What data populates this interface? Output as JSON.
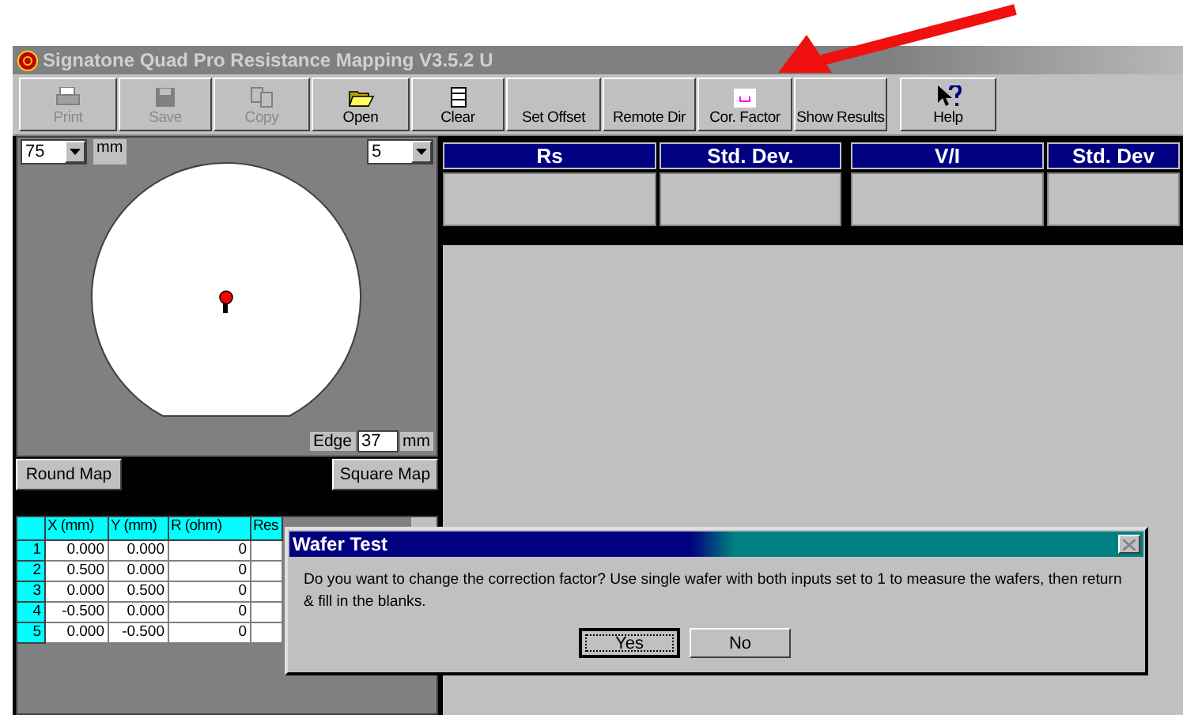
{
  "window": {
    "title": "Signatone Quad Pro Resistance Mapping V3.5.2 U"
  },
  "toolbar": [
    {
      "label": "Print",
      "kind": "printer",
      "disabled": true
    },
    {
      "label": "Save",
      "kind": "disk",
      "disabled": true
    },
    {
      "label": "Copy",
      "kind": "copy",
      "disabled": true
    },
    {
      "label": "Open",
      "kind": "folder",
      "disabled": false
    },
    {
      "label": "Clear",
      "kind": "page",
      "disabled": false
    },
    {
      "label": "Set Offset",
      "kind": "text",
      "disabled": false
    },
    {
      "label": "Remote Dir",
      "kind": "text",
      "disabled": false
    },
    {
      "label": "Cor. Factor",
      "kind": "factor",
      "disabled": false
    },
    {
      "label": "Show Results",
      "kind": "text",
      "disabled": false
    },
    {
      "label": "Help",
      "kind": "help",
      "disabled": false
    }
  ],
  "map": {
    "diameter": "75",
    "diameter_unit": "mm",
    "points": "5",
    "edge_label": "Edge",
    "edge": "37",
    "edge_unit": "mm"
  },
  "map_buttons": [
    "Round Map",
    "Square Map"
  ],
  "results": [
    {
      "columns": [
        "Rs",
        "Std. Dev."
      ]
    },
    {
      "columns": [
        "V/I",
        "Std. Dev"
      ]
    }
  ],
  "table": {
    "columns": [
      "X (mm)",
      "Y (mm)",
      "R (ohm)",
      "Res"
    ],
    "rows": [
      {
        "n": "1",
        "cells": [
          "0.000",
          "0.000",
          "0"
        ]
      },
      {
        "n": "2",
        "cells": [
          "0.500",
          "0.000",
          "0"
        ]
      },
      {
        "n": "3",
        "cells": [
          "0.000",
          "0.500",
          "0"
        ]
      },
      {
        "n": "4",
        "cells": [
          "-0.500",
          "0.000",
          "0"
        ]
      },
      {
        "n": "5",
        "cells": [
          "0.000",
          "-0.500",
          "0"
        ]
      }
    ]
  },
  "dialog": {
    "title": "Wafer Test",
    "message": "Do you want to change the correction factor?  Use single wafer with both inputs set to 1 to measure the wafers, then return & fill in the blanks.",
    "buttons": [
      {
        "label": "Yes",
        "selected": true
      },
      {
        "label": "No",
        "selected": false
      }
    ]
  }
}
